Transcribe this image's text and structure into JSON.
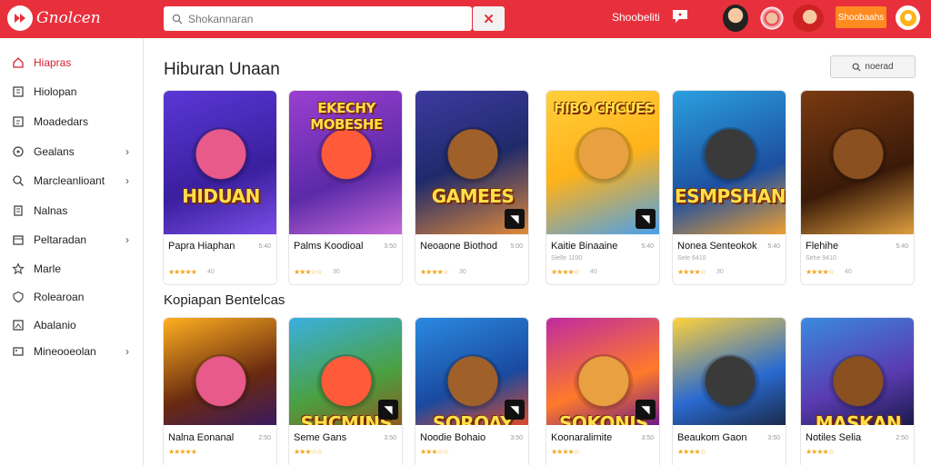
{
  "header": {
    "brand": "Gnolcen",
    "search_placeholder": "Shokannaran",
    "top_link": "Shoobeliti",
    "cta_label": "Shoobaahs",
    "icons": [
      "logo-icon",
      "search-icon",
      "close-icon",
      "chat-icon",
      "profile-icon"
    ],
    "brand_color": "#e8303c",
    "cta_color": "#ff8a1f"
  },
  "sidebar": {
    "items": [
      {
        "label": "Hiapras",
        "icon": "home-icon",
        "chevron": false,
        "active": true
      },
      {
        "label": "Hiolopan",
        "icon": "grid-icon",
        "chevron": false,
        "active": false
      },
      {
        "label": "Moadedars",
        "icon": "list-icon",
        "chevron": false,
        "active": false
      },
      {
        "label": "Gealans",
        "icon": "location-icon",
        "chevron": true,
        "active": false
      },
      {
        "label": "Marcleanlioant",
        "icon": "search-icon",
        "chevron": true,
        "active": false
      },
      {
        "label": "Nalnas",
        "icon": "document-icon",
        "chevron": false,
        "active": false
      },
      {
        "label": "Peltaradan",
        "icon": "calendar-icon",
        "chevron": true,
        "active": false
      },
      {
        "label": "Marle",
        "icon": "star-icon",
        "chevron": false,
        "active": false
      },
      {
        "label": "Rolearoan",
        "icon": "shield-icon",
        "chevron": false,
        "active": false
      },
      {
        "label": "Abalanio",
        "icon": "image-icon",
        "chevron": false,
        "active": false
      },
      {
        "label": "Mineooeolan",
        "icon": "tag-icon",
        "chevron": true,
        "active": false
      }
    ]
  },
  "main": {
    "section1_title": "Hiburan Unaan",
    "section2_title": "Kopiapan Bentelcas",
    "filter_label": "noerad",
    "row1": [
      {
        "name": "Papra Hiaphan",
        "size": "5:40",
        "meta": "",
        "stars": 5,
        "rating": "40",
        "art": "HIDUAN"
      },
      {
        "name": "Palms Koodioal",
        "size": "3:50",
        "meta": "",
        "stars": 3,
        "rating": "30",
        "art": "EKECHY MOBESHE"
      },
      {
        "name": "Neoaone Biothod",
        "size": "5:00",
        "meta": "",
        "stars": 4,
        "rating": "30",
        "art": "GAMEES"
      },
      {
        "name": "Kaitie Binaaine",
        "size": "5:40",
        "meta": "Slelle 1100",
        "stars": 4,
        "rating": "40",
        "art": "HIBO CHCUES"
      },
      {
        "name": "Nonea Senteokok",
        "size": "5:40",
        "meta": "Sele 6410",
        "stars": 4,
        "rating": "30",
        "art": "ESMPSHAN"
      },
      {
        "name": "Flehihe",
        "size": "5:40",
        "meta": "Sehe 9410",
        "stars": 4,
        "rating": "40",
        "art": ""
      }
    ],
    "row2": [
      {
        "name": "Nalna Eonanal",
        "size": "2:50",
        "stars": 5,
        "art": ""
      },
      {
        "name": "Seme Gans",
        "size": "3:50",
        "stars": 3,
        "art": "SHCMINS"
      },
      {
        "name": "Noodie Bohaio",
        "size": "3:50",
        "stars": 3,
        "art": "SOROAY"
      },
      {
        "name": "Koonaralimite",
        "size": "3:50",
        "stars": 4,
        "art": "SOKONIS"
      },
      {
        "name": "Beaukom Gaon",
        "size": "3:50",
        "stars": 4,
        "art": ""
      },
      {
        "name": "Notiles Selia",
        "size": "2:50",
        "stars": 4,
        "art": "MASKAN"
      }
    ]
  }
}
